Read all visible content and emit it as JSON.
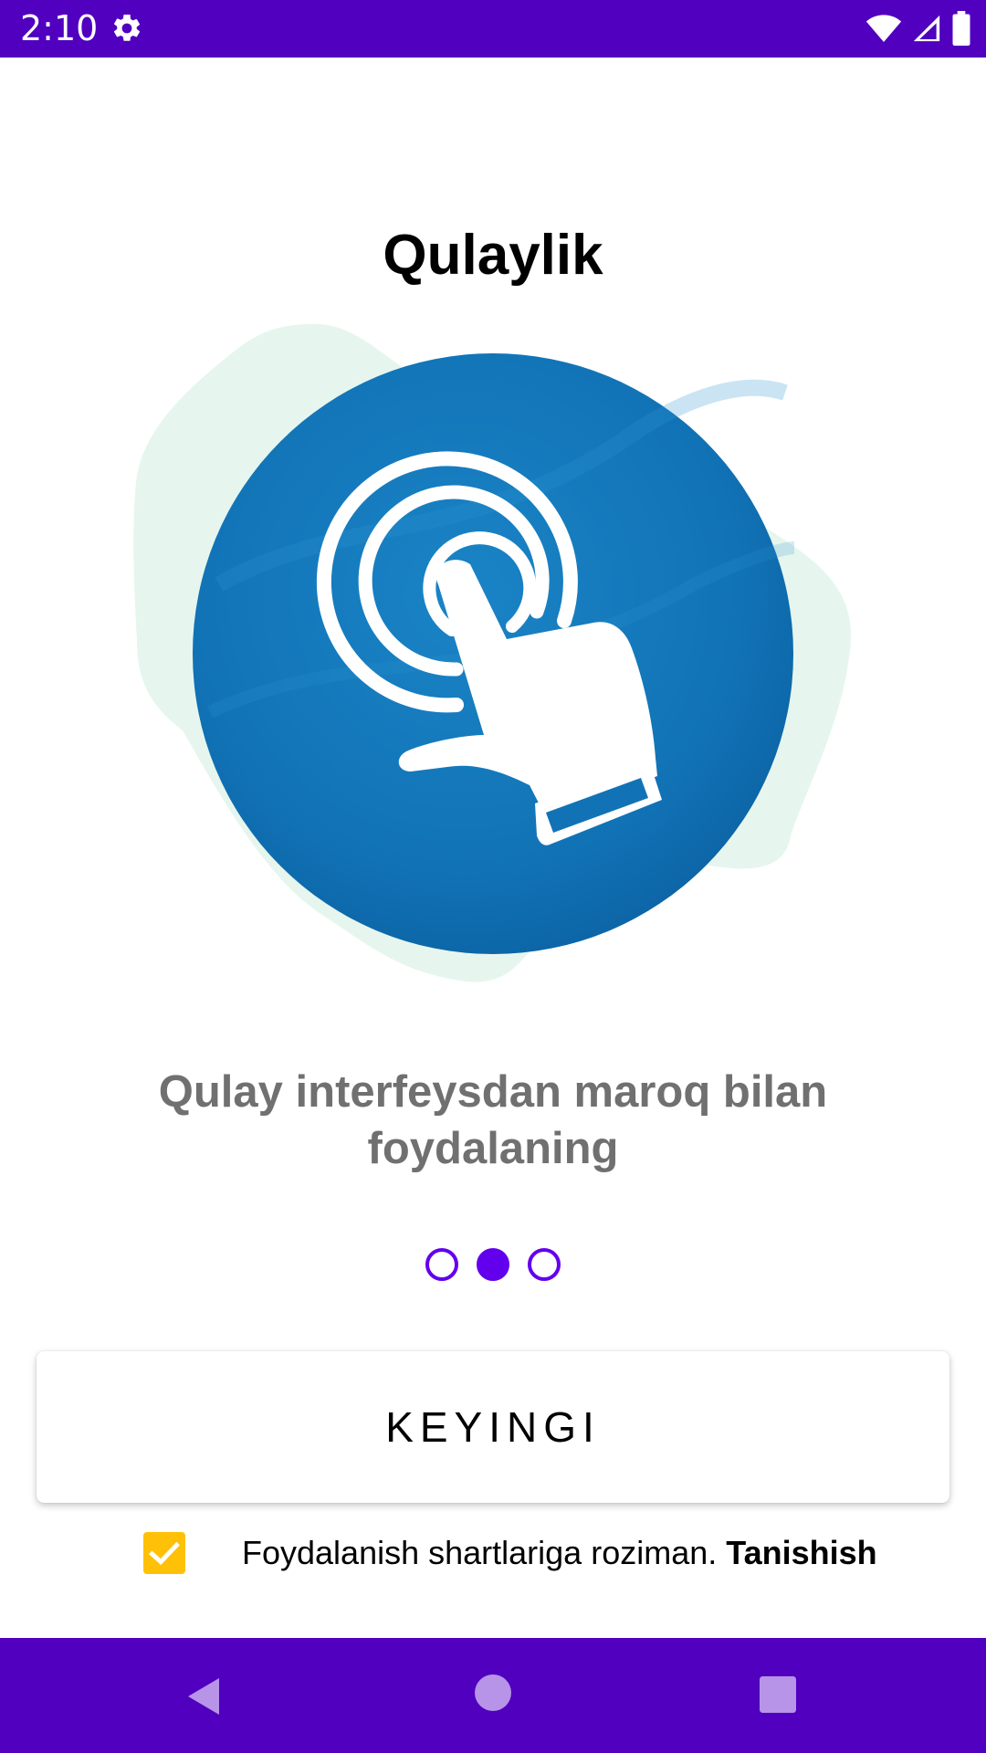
{
  "status_bar": {
    "time": "2:10",
    "settings_icon": "gear-icon",
    "wifi_icon": "wifi-icon",
    "signal_icon": "cell-signal-icon",
    "battery_icon": "battery-icon",
    "background": "#5000BE"
  },
  "onboarding": {
    "title": "Qulaylik",
    "illustration_icon": "tap-hand-icon",
    "description": "Qulay interfeysdan maroq bilan foydalaning",
    "pager": {
      "total": 3,
      "active_index": 1
    },
    "accent_color": "#6200EE"
  },
  "actions": {
    "next_label": "KEYINGI"
  },
  "terms": {
    "checked": true,
    "text": "Foydalanish shartlariga roziman. ",
    "link_label": "Tanishish",
    "checkbox_color": "#FFC107"
  },
  "nav_bar": {
    "back_icon": "back-triangle-icon",
    "home_icon": "home-circle-icon",
    "recent_icon": "recent-apps-square-icon",
    "background": "#5000BE"
  }
}
